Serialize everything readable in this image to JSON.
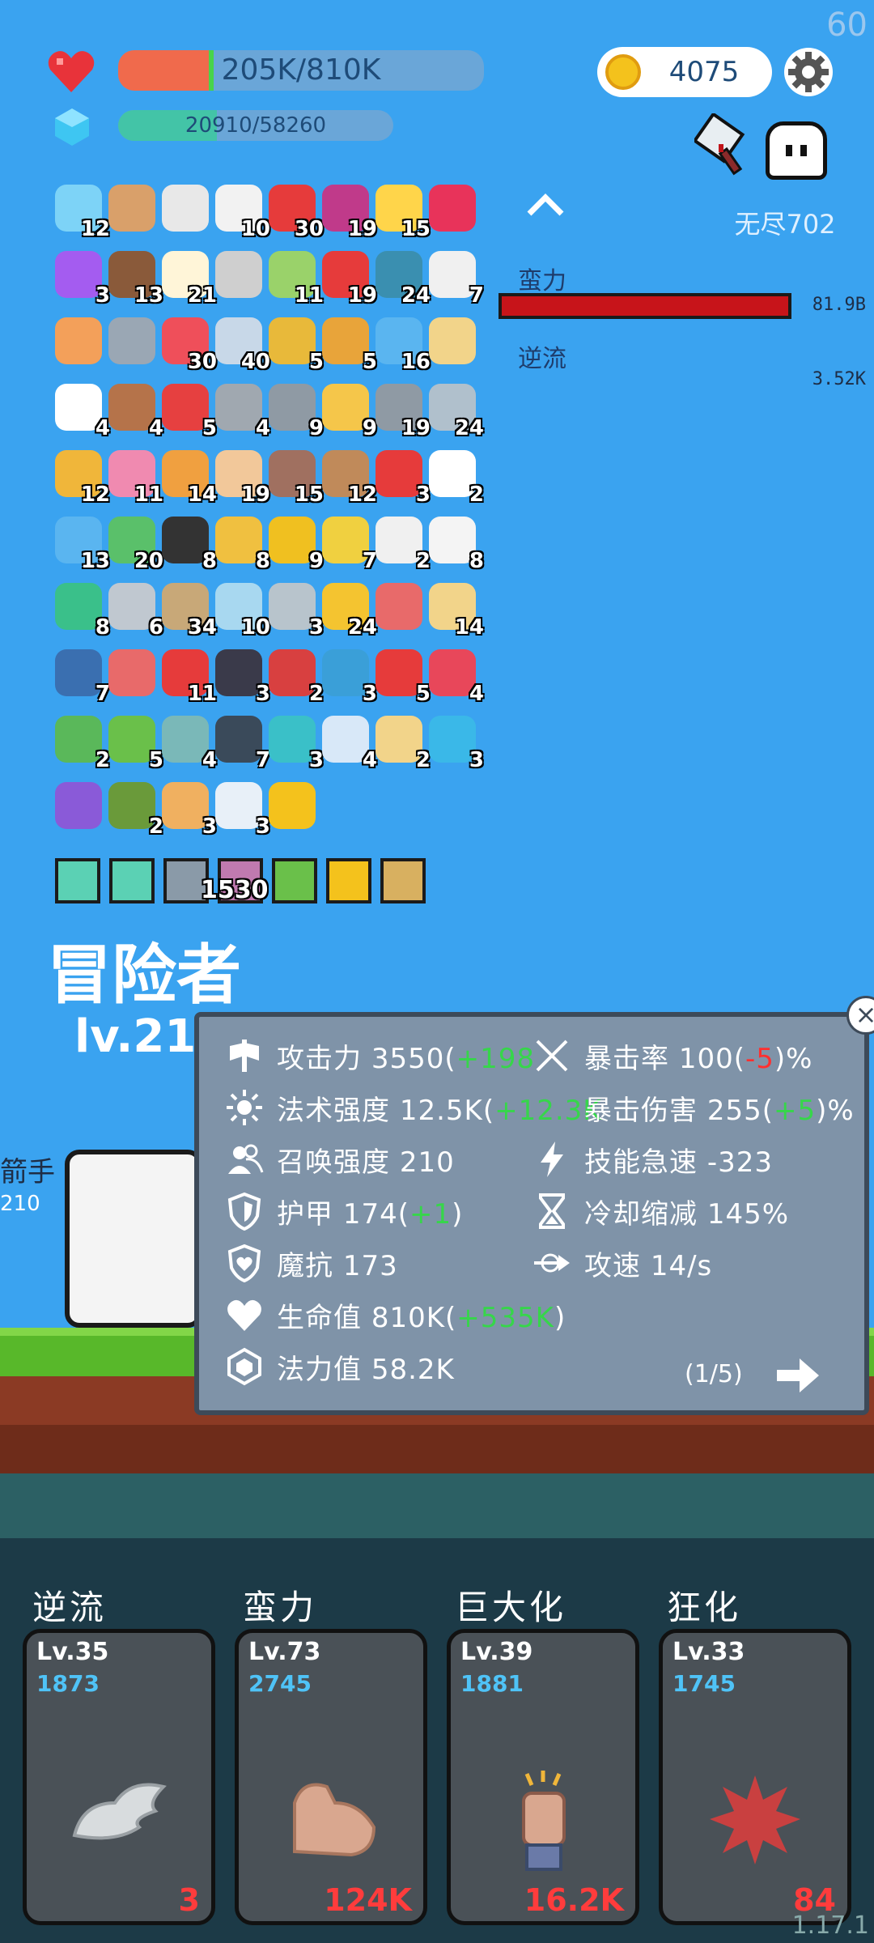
{
  "fps": "60",
  "hp": {
    "text": "205K/810K",
    "fraction": 0.26
  },
  "mp": {
    "text": "20910/58260",
    "fraction": 0.36
  },
  "gold": "4075",
  "wave": "无尽702",
  "boss": {
    "label_power": "蛮力",
    "label_flow": "逆流",
    "hp_value": "81.9B",
    "dmg_value": "3.52K"
  },
  "colors": {
    "sky": "#3aa3f0",
    "hp": "#f06a4c",
    "mp": "#43c4a7",
    "panel": "#7f93a8",
    "green": "#36d64a",
    "red": "#ff3030"
  },
  "items": [
    {
      "icon": "pen-icon",
      "count": "12",
      "c": "#7dd3f7"
    },
    {
      "icon": "bow-icon",
      "count": "",
      "c": "#d9a06a"
    },
    {
      "icon": "sword-icon",
      "count": "",
      "c": "#e8e8e8"
    },
    {
      "icon": "envelope-icon",
      "count": "10",
      "c": "#f2f2f2"
    },
    {
      "icon": "apple-icon",
      "count": "30",
      "c": "#e63b3b"
    },
    {
      "icon": "target-icon",
      "count": "19",
      "c": "#c03a8a"
    },
    {
      "icon": "sun-icon",
      "count": "15",
      "c": "#ffd54a"
    },
    {
      "icon": "ruby-icon",
      "count": "",
      "c": "#e8335a"
    },
    {
      "icon": "potion-icon",
      "count": "3",
      "c": "#a45cf0"
    },
    {
      "icon": "coconut-icon",
      "count": "13",
      "c": "#8a5a3a"
    },
    {
      "icon": "egg-icon",
      "count": "21",
      "c": "#fff5d8"
    },
    {
      "icon": "hook-icon",
      "count": "",
      "c": "#cfcfcf"
    },
    {
      "icon": "crossbow-icon",
      "count": "11",
      "c": "#9ad26a"
    },
    {
      "icon": "strawberry-icon",
      "count": "19",
      "c": "#e63b3b"
    },
    {
      "icon": "chat-icon",
      "count": "24",
      "c": "#3a8fb0"
    },
    {
      "icon": "cloud-icon",
      "count": "7",
      "c": "#f0f0f0"
    },
    {
      "icon": "scroll-icon",
      "count": "",
      "c": "#f3a05a"
    },
    {
      "icon": "helmet-icon",
      "count": "",
      "c": "#9aa7b4"
    },
    {
      "icon": "heart-icon",
      "count": "30",
      "c": "#ef4f5a"
    },
    {
      "icon": "molecule-icon",
      "count": "40",
      "c": "#c8d8e8"
    },
    {
      "icon": "cocoon-icon",
      "count": "5",
      "c": "#e8b93a"
    },
    {
      "icon": "book-icon",
      "count": "5",
      "c": "#e8a43a"
    },
    {
      "icon": "star-card-icon",
      "count": "16",
      "c": "#5ab5f0"
    },
    {
      "icon": "parchment-icon",
      "count": "",
      "c": "#f2d48a"
    },
    {
      "icon": "ghost-icon",
      "count": "4",
      "c": "#ffffff"
    },
    {
      "icon": "shield-round-icon",
      "count": "4",
      "c": "#b5734a"
    },
    {
      "icon": "sock-icon",
      "count": "5",
      "c": "#e64040"
    },
    {
      "icon": "compass-icon",
      "count": "4",
      "c": "#a0a8b0"
    },
    {
      "icon": "mace-icon",
      "count": "9",
      "c": "#8f9aa4"
    },
    {
      "icon": "beer-icon",
      "count": "9",
      "c": "#f5c64a"
    },
    {
      "icon": "axe-icon",
      "count": "19",
      "c": "#8f9aa4"
    },
    {
      "icon": "dagger-icon",
      "count": "24",
      "c": "#b0c0cc"
    },
    {
      "icon": "pineapple-icon",
      "count": "12",
      "c": "#f0b63a"
    },
    {
      "icon": "bottle-icon",
      "count": "11",
      "c": "#f08ab0"
    },
    {
      "icon": "briefcase-icon",
      "count": "14",
      "c": "#f0a040"
    },
    {
      "icon": "fist-icon",
      "count": "19",
      "c": "#f2c89a"
    },
    {
      "icon": "tombstone-icon",
      "count": "15",
      "c": "#a07060"
    },
    {
      "icon": "flag-icon",
      "count": "12",
      "c": "#c08a5a"
    },
    {
      "icon": "percent-icon",
      "count": "3",
      "c": "#e63b3b"
    },
    {
      "icon": "flower-icon",
      "count": "2",
      "c": "#ffffff"
    },
    {
      "icon": "cat-icon",
      "count": "13",
      "c": "#5ab5f0"
    },
    {
      "icon": "money-heart-icon",
      "count": "20",
      "c": "#5ac06a"
    },
    {
      "icon": "cauldron-icon",
      "count": "8",
      "c": "#333333"
    },
    {
      "icon": "ring-icon",
      "count": "8",
      "c": "#f0c040"
    },
    {
      "icon": "sunflower-icon",
      "count": "9",
      "c": "#f0c020"
    },
    {
      "icon": "wand-icon",
      "count": "7",
      "c": "#f0d040"
    },
    {
      "icon": "cards-icon",
      "count": "2",
      "c": "#f0f0f0"
    },
    {
      "icon": "dice-icon",
      "count": "8",
      "c": "#f4f4f4"
    },
    {
      "icon": "gourd-icon",
      "count": "8",
      "c": "#3ac08a"
    },
    {
      "icon": "meteor-icon",
      "count": "6",
      "c": "#c0c8d0"
    },
    {
      "icon": "noose-icon",
      "count": "34",
      "c": "#c8a878"
    },
    {
      "icon": "robe-icon",
      "count": "10",
      "c": "#a8d8f0"
    },
    {
      "icon": "blade-icon",
      "count": "3",
      "c": "#b8c4cc"
    },
    {
      "icon": "cheese-icon",
      "count": "24",
      "c": "#f4c430"
    },
    {
      "icon": "heart-badge-icon",
      "count": "",
      "c": "#e86a6a"
    },
    {
      "icon": "map-icon",
      "count": "14",
      "c": "#f2d48a"
    },
    {
      "icon": "shield-icon",
      "count": "7",
      "c": "#3a6fb0"
    },
    {
      "icon": "steak-icon",
      "count": "",
      "c": "#e86a6a"
    },
    {
      "icon": "gift-icon",
      "count": "11",
      "c": "#e63b3b"
    },
    {
      "icon": "bat-icon",
      "count": "3",
      "c": "#3a3a4a"
    },
    {
      "icon": "crest-icon",
      "count": "2",
      "c": "#d84040"
    },
    {
      "icon": "crosshair-icon",
      "count": "3",
      "c": "#3a9fd8"
    },
    {
      "icon": "mushroom-icon",
      "count": "5",
      "c": "#e63b3b"
    },
    {
      "icon": "watermelon-icon",
      "count": "4",
      "c": "#e8475a"
    },
    {
      "icon": "zombie-icon",
      "count": "2",
      "c": "#5ab85a"
    },
    {
      "icon": "lime-icon",
      "count": "5",
      "c": "#6ac04a"
    },
    {
      "icon": "disc-icon",
      "count": "4",
      "c": "#7ab8b8"
    },
    {
      "icon": "skull-book-icon",
      "count": "7",
      "c": "#3a4a5a"
    },
    {
      "icon": "spiral-icon",
      "count": "3",
      "c": "#3ac0c8"
    },
    {
      "icon": "halo-icon",
      "count": "4",
      "c": "#d8e8f8"
    },
    {
      "icon": "treasure-map-icon",
      "count": "2",
      "c": "#f2d48a"
    },
    {
      "icon": "sapphire-icon",
      "count": "3",
      "c": "#3ab8e8"
    },
    {
      "icon": "hat-icon",
      "count": "",
      "c": "#8a5ad8"
    },
    {
      "icon": "grenade-icon",
      "count": "2",
      "c": "#6a9a3a"
    },
    {
      "icon": "scroll-paper-icon",
      "count": "3",
      "c": "#f0b060"
    },
    {
      "icon": "bulb-icon",
      "count": "3",
      "c": "#e8f0f8"
    },
    {
      "icon": "coins-icon",
      "count": "",
      "c": "#f4c21c"
    }
  ],
  "slots": {
    "count": "1530",
    "colors": [
      "#5bd1b4",
      "#5bd1b4",
      "#8a9aa8",
      "#c07ab0",
      "#6ac04a",
      "#f4c21c",
      "#d8b060"
    ]
  },
  "hero": {
    "title": "冒险者",
    "level": "lv.21",
    "name": "箭手",
    "dmg": "210"
  },
  "stats": {
    "attack": {
      "label": "攻击力",
      "value": "3550",
      "bonus": "+198"
    },
    "spell": {
      "label": "法术强度",
      "value": "12.5K",
      "bonus": "+12.3K"
    },
    "summon": {
      "label": "召唤强度",
      "value": "210"
    },
    "armor": {
      "label": "护甲",
      "value": "174",
      "bonus": "+1"
    },
    "magic_res": {
      "label": "魔抗",
      "value": "173"
    },
    "hp": {
      "label": "生命值",
      "value": "810K",
      "bonus": "+535K"
    },
    "mana": {
      "label": "法力值",
      "value": "58.2K"
    },
    "crit_rate": {
      "label": "暴击率",
      "value": "100",
      "bonus": "-5",
      "unit": "%"
    },
    "crit_dmg": {
      "label": "暴击伤害",
      "value": "255",
      "bonus": "+5",
      "unit": "%"
    },
    "haste": {
      "label": "技能急速",
      "value": "-323"
    },
    "cdr": {
      "label": "冷却缩减",
      "value": "145%"
    },
    "atk_speed": {
      "label": "攻速",
      "value": "14/s"
    },
    "page": "(1/5)"
  },
  "skills": [
    {
      "name": "逆流",
      "level": "Lv.35",
      "points": "1873",
      "value": "3",
      "icon": "wing-icon"
    },
    {
      "name": "蛮力",
      "level": "Lv.73",
      "points": "2745",
      "value": "124K",
      "icon": "muscle-icon"
    },
    {
      "name": "巨大化",
      "level": "Lv.39",
      "points": "1881",
      "value": "16.2K",
      "icon": "raised-fist-icon"
    },
    {
      "name": "狂化",
      "level": "Lv.33",
      "points": "1745",
      "value": "84",
      "icon": "rage-splash-icon"
    }
  ],
  "version": "1.17.1"
}
